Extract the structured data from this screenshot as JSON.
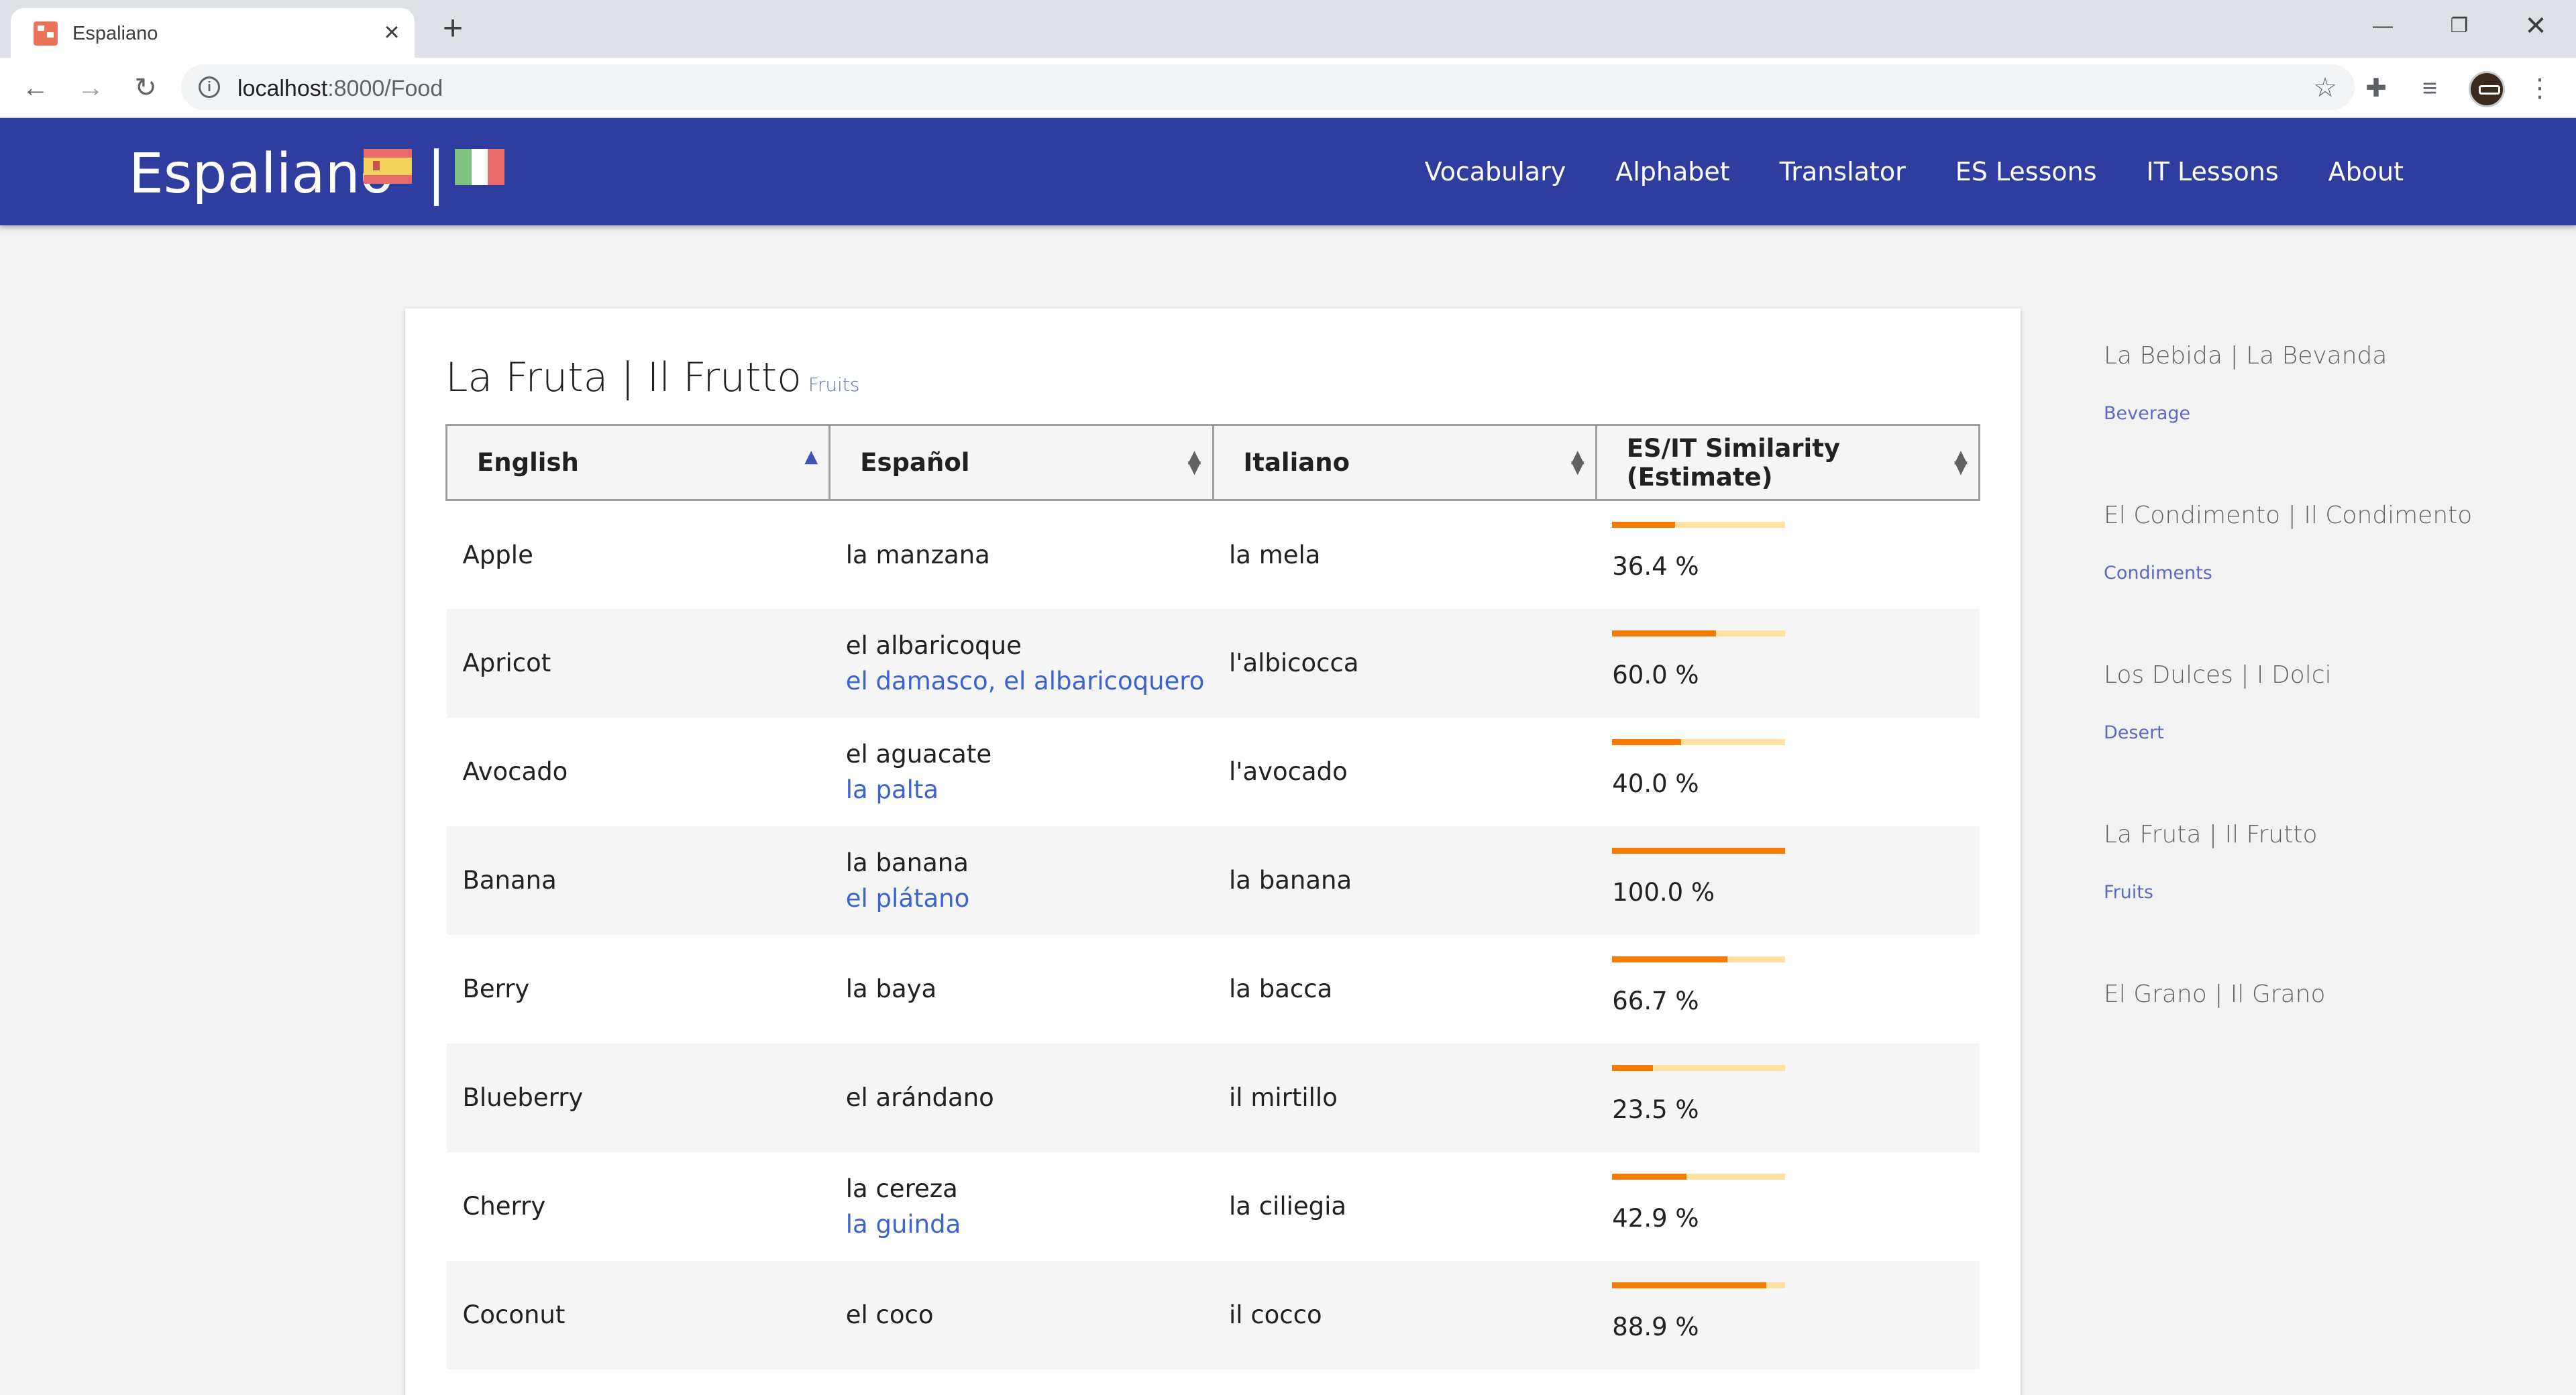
{
  "browser": {
    "tab_title": "Espaliano",
    "url_host": "localhost",
    "url_rest": ":8000/Food"
  },
  "app": {
    "brand": "Espaliano",
    "separator": "|",
    "nav": [
      "Vocabulary",
      "Alphabet",
      "Translator",
      "ES Lessons",
      "IT Lessons",
      "About"
    ]
  },
  "card": {
    "title": "La Fruta | Il Frutto",
    "subtitle": "Fruits",
    "columns": [
      "English",
      "Español",
      "Italiano",
      "ES/IT Similarity (Estimate)"
    ],
    "rows": [
      {
        "en": "Apple",
        "es": "la manzana",
        "es_alt": "",
        "it": "la mela",
        "sim": 36.4,
        "sim_text": "36.4 %"
      },
      {
        "en": "Apricot",
        "es": "el albaricoque",
        "es_alt": "el damasco, el albaricoquero",
        "it": "l'albicocca",
        "sim": 60.0,
        "sim_text": "60.0 %"
      },
      {
        "en": "Avocado",
        "es": "el aguacate",
        "es_alt": "la palta",
        "it": "l'avocado",
        "sim": 40.0,
        "sim_text": "40.0 %"
      },
      {
        "en": "Banana",
        "es": "la banana",
        "es_alt": "el plátano",
        "it": "la banana",
        "sim": 100.0,
        "sim_text": "100.0 %"
      },
      {
        "en": "Berry",
        "es": "la baya",
        "es_alt": "",
        "it": "la bacca",
        "sim": 66.7,
        "sim_text": "66.7 %"
      },
      {
        "en": "Blueberry",
        "es": "el arándano",
        "es_alt": "",
        "it": "il mirtillo",
        "sim": 23.5,
        "sim_text": "23.5 %"
      },
      {
        "en": "Cherry",
        "es": "la cereza",
        "es_alt": "la guinda",
        "it": "la ciliegia",
        "sim": 42.9,
        "sim_text": "42.9 %"
      },
      {
        "en": "Coconut",
        "es": "el coco",
        "es_alt": "",
        "it": "il cocco",
        "sim": 88.9,
        "sim_text": "88.9 %"
      }
    ]
  },
  "sidebar": [
    {
      "title": "La Bebida | La Bevanda",
      "sub": "Beverage"
    },
    {
      "title": "El Condimento | Il Condimento",
      "sub": "Condiments"
    },
    {
      "title": "Los Dulces | I Dolci",
      "sub": "Desert"
    },
    {
      "title": "La Fruta | Il Frutto",
      "sub": "Fruits"
    },
    {
      "title": "El Grano | Il Grano",
      "sub": ""
    }
  ],
  "colors": {
    "accent": "#2f3e9e",
    "bar_fill": "#f57c00",
    "bar_track": "#ffe1a3",
    "link": "#3b63d1"
  }
}
